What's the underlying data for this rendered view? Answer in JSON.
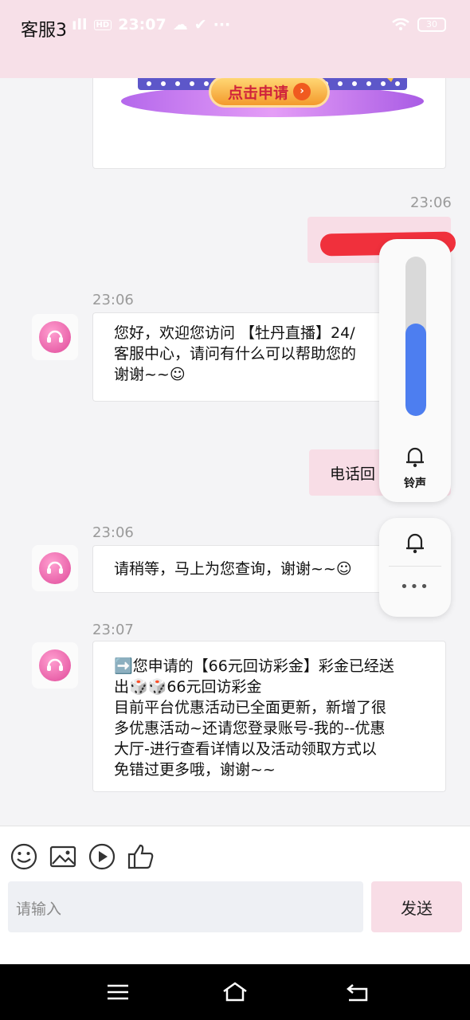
{
  "header": {
    "title": "客服3"
  },
  "status_bar": {
    "time": "23:07",
    "hd": "HD",
    "battery": "30"
  },
  "banner": {
    "apply_label": "点击申请",
    "arrow": "›"
  },
  "messages": {
    "out1_time": "23:06",
    "in1_time": "23:06",
    "in1_lines": [
      "您好，欢迎您访问 【牡丹直播】24/",
      "客服中心，请问有什么可以帮助您的",
      "谢谢~~☺"
    ],
    "out2_text": "电话回",
    "in2_time": "23:06",
    "in2_text": "请稍等，马上为您查询，谢谢~~☺",
    "in3_time": "23:07",
    "in3_lines": [
      "➡️您申请的【66元回访彩金】彩金已经送",
      "出🎲🎲66元回访彩金",
      "目前平台优惠活动已全面更新，新增了很",
      "多优惠活动~还请您登录账号-我的--优惠",
      "大厅-进行查看详情以及活动领取方式以",
      "免错过更多哦，谢谢~~"
    ]
  },
  "volume_panel": {
    "ring_label": "铃声",
    "level": 0.58,
    "more": "•••"
  },
  "composer": {
    "placeholder": "请输入",
    "send_label": "发送"
  },
  "icons": {
    "toolbar": [
      "emoji-icon",
      "image-icon",
      "video-icon",
      "thumbs-up-icon"
    ],
    "nav": [
      "menu-icon",
      "home-icon",
      "back-icon"
    ]
  },
  "colors": {
    "header_bg": "#f7e0e8",
    "out_bubble": "#f8dde6",
    "volume": "#4d7ef0",
    "scribble": "#f0303c"
  }
}
